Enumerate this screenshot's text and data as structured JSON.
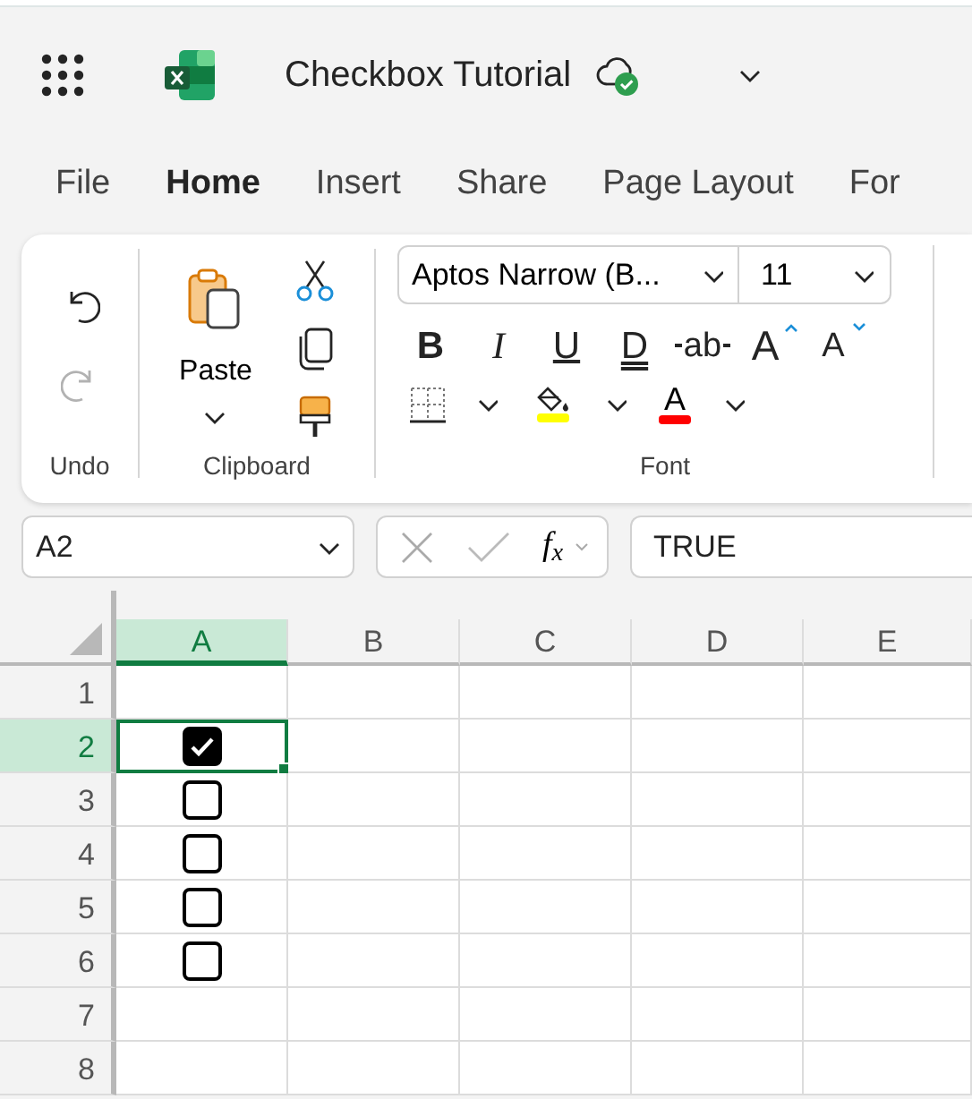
{
  "document_title": "Checkbox Tutorial",
  "tabs": [
    {
      "label": "File",
      "selected": false
    },
    {
      "label": "Home",
      "selected": true
    },
    {
      "label": "Insert",
      "selected": false
    },
    {
      "label": "Share",
      "selected": false
    },
    {
      "label": "Page Layout",
      "selected": false
    },
    {
      "label": "For",
      "selected": false
    }
  ],
  "ribbon": {
    "undo": {
      "disabled": false
    },
    "redo": {
      "disabled": true
    },
    "undo_group_label": "Undo",
    "paste_label": "Paste",
    "clipboard_group_label": "Clipboard",
    "font_name": "Aptos Narrow (B...",
    "font_size": "11",
    "format_buttons": [
      {
        "kind": "bold",
        "glyph": "B"
      },
      {
        "kind": "italic",
        "glyph": "I"
      },
      {
        "kind": "underline",
        "glyph": "U"
      },
      {
        "kind": "double_underline",
        "glyph": "D"
      },
      {
        "kind": "strikethrough",
        "glyph": "ab"
      },
      {
        "kind": "grow",
        "glyph": "A"
      },
      {
        "kind": "shrink",
        "glyph": "A"
      }
    ],
    "fill_color": {
      "color": "#ffff00"
    },
    "font_color": {
      "glyph": "A",
      "color": "#ff0000"
    },
    "font_group_label": "Font"
  },
  "formula_bar": {
    "name_box": "A2",
    "function_label": "f$_{x}$",
    "formula": "TRUE"
  },
  "grid": {
    "columns": [
      {
        "label": "A",
        "selected": true
      },
      {
        "label": "B",
        "selected": false
      },
      {
        "label": "C",
        "selected": false
      },
      {
        "label": "D",
        "selected": false
      },
      {
        "label": "E",
        "selected": false
      }
    ],
    "rows": [
      {
        "label": "1",
        "selected": false
      },
      {
        "label": "2",
        "selected": true,
        "checkbox": {
          "checked": true
        }
      },
      {
        "label": "3",
        "selected": false,
        "checkbox": {
          "checked": false
        }
      },
      {
        "label": "4",
        "selected": false,
        "checkbox": {
          "checked": false
        }
      },
      {
        "label": "5",
        "selected": false,
        "checkbox": {
          "checked": false
        }
      },
      {
        "label": "6",
        "selected": false,
        "checkbox": {
          "checked": false
        }
      },
      {
        "label": "7",
        "selected": false
      },
      {
        "label": "8",
        "selected": false
      }
    ]
  }
}
